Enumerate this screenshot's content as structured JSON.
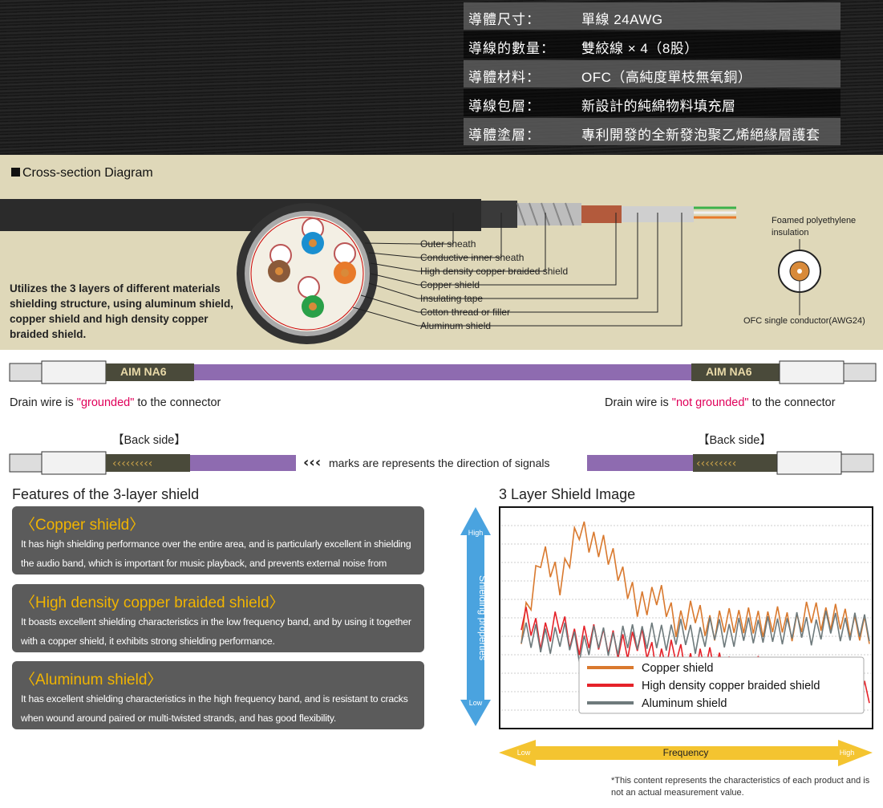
{
  "specs": [
    {
      "key": "導體尺寸：",
      "value": "單線 24AWG"
    },
    {
      "key": "導線的數量：",
      "value": "雙絞線 × 4（8股）"
    },
    {
      "key": "導體材料：",
      "value": "OFC（高純度單枝無氧銅）"
    },
    {
      "key": "導線包層：",
      "value": "新設計的純綿物料填充層"
    },
    {
      "key": "導體塗層：",
      "value": "專利開發的全新發泡聚乙烯絕緣層護套"
    }
  ],
  "cross_section": {
    "title": "Cross-section Diagram",
    "description": "Utilizes the 3 layers of different materials shielding structure, using aluminum shield, copper shield and high density copper braided shield.",
    "callouts": [
      "Outer sheath",
      "Conductive  inner sheath",
      "High density copper braided shield",
      "Copper shield",
      "Insulating tape",
      "Cotton thread or filler",
      "Aluminum shield"
    ],
    "foamed_label": "Foamed polyethylene insulation",
    "ofc_label": "OFC single conductor(AWG24)"
  },
  "cable": {
    "brand": "AIM NA6",
    "drain_left_pre": "Drain wire is ",
    "drain_left_hl": "\"grounded\"",
    "drain_left_post": " to the connector",
    "drain_right_pre": "Drain wire is ",
    "drain_right_hl": "\"not grounded\"",
    "drain_right_post": " to the connector",
    "back_side": "【Back side】",
    "signal_note": "marks are represents the direction of signals"
  },
  "features": {
    "heading": "Features of the 3-layer shield",
    "items": [
      {
        "title": "〈Copper shield〉",
        "desc": "It has high shielding performance over the entire area, and is particularly excellent in shielding the audio band, which is important for music playback, and prevents external noise from entering."
      },
      {
        "title": "〈High density copper braided shield〉",
        "desc": "It boasts excellent shielding characteristics in the low frequency band, and by using it together with a copper shield, it exhibits strong shielding performance."
      },
      {
        "title": "〈Aluminum shield〉",
        "desc": "It has excellent shielding characteristics in the high frequency band, and is resistant to cracks when wound around paired or multi-twisted strands, and has good flexibility."
      }
    ]
  },
  "chart_data": {
    "type": "line",
    "title": "3 Layer Shield Image",
    "xlabel": "Frequency",
    "ylabel": "Shielding properties",
    "x_low": "Low",
    "x_high": "High",
    "y_low": "Low",
    "y_high": "High",
    "legend_placement": "bottom-right",
    "series": [
      {
        "name": "Copper shield",
        "color": "#d9792e",
        "values": [
          0.42,
          0.8,
          0.68,
          0.92,
          0.85,
          0.75,
          0.55,
          0.62,
          0.48,
          0.52,
          0.45,
          0.5,
          0.47,
          0.49,
          0.46,
          0.52,
          0.5,
          0.48,
          0.42
        ]
      },
      {
        "name": "High density copper braided shield",
        "color": "#e52229",
        "values": [
          0.5,
          0.42,
          0.47,
          0.38,
          0.42,
          0.35,
          0.4,
          0.3,
          0.33,
          0.27,
          0.31,
          0.22,
          0.26,
          0.2,
          0.25,
          0.18,
          0.22,
          0.16,
          0.15
        ]
      },
      {
        "name": "Aluminum shield",
        "color": "#6e7a7c",
        "values": [
          0.45,
          0.38,
          0.42,
          0.36,
          0.4,
          0.38,
          0.42,
          0.4,
          0.43,
          0.4,
          0.44,
          0.42,
          0.45,
          0.43,
          0.46,
          0.44,
          0.47,
          0.45,
          0.46
        ]
      }
    ]
  },
  "note": "*This content represents the characteristics of each product and is not an actual measurement value."
}
